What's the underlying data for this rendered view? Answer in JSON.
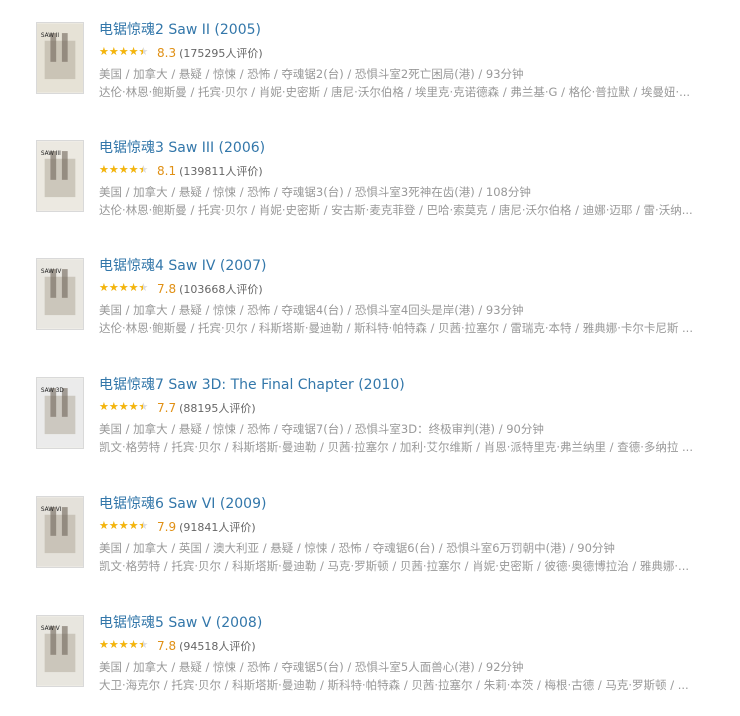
{
  "movies": [
    {
      "title": "电锯惊魂2 Saw II (2005)",
      "rating": 8.3,
      "stars_fraction": 0.8,
      "score": "8.3",
      "votes": "(175295人评价)",
      "meta": "美国 / 加拿大 / 悬疑 / 惊悚 / 恐怖 / 夺魂锯2(台) / 恐惧斗室2死亡困局(港) / 93分钟",
      "cast": "达伦·林恩·鲍斯曼 / 托宾·贝尔 / 肖妮·史密斯 / 唐尼·沃尔伯格 / 埃里克·克诺德森 / 弗兰基·G / 格伦·普拉默 / 埃曼妞·...",
      "poster_label": "SAW II",
      "poster_color": "#e6e2d6"
    },
    {
      "title": "电锯惊魂3 Saw III (2006)",
      "rating": 8.1,
      "stars_fraction": 0.8,
      "score": "8.1",
      "votes": "(139811人评价)",
      "meta": "美国 / 加拿大 / 悬疑 / 惊悚 / 恐怖 / 夺魂锯3(台) / 恐惧斗室3死神在齿(港) / 108分钟",
      "cast": "达伦·林恩·鲍斯曼 / 托宾·贝尔 / 肖妮·史密斯 / 安古斯·麦克菲登 / 巴哈·索莫克 / 唐尼·沃尔伯格 / 迪娜·迈耶 / 雷·沃纳...",
      "poster_label": "SAW III",
      "poster_color": "#ece9e1"
    },
    {
      "title": "电锯惊魂4 Saw IV (2007)",
      "rating": 7.8,
      "stars_fraction": 0.8,
      "score": "7.8",
      "votes": "(103668人评价)",
      "meta": "美国 / 加拿大 / 悬疑 / 惊悚 / 恐怖 / 夺魂锯4(台) / 恐惧斗室4回头是岸(港) / 93分钟",
      "cast": "达伦·林恩·鲍斯曼 / 托宾·贝尔 / 科斯塔斯·曼迪勒 / 斯科特·帕特森 / 贝茜·拉塞尔 / 雷瑞克·本特 / 雅典娜·卡尔卡尼斯 ...",
      "poster_label": "SAW IV",
      "poster_color": "#e9e7e1"
    },
    {
      "title": "电锯惊魂7 Saw 3D: The Final Chapter (2010)",
      "rating": 7.7,
      "stars_fraction": 0.8,
      "score": "7.7",
      "votes": "(88195人评价)",
      "meta": "美国 / 加拿大 / 悬疑 / 惊悚 / 恐怖 / 夺魂锯7(台) / 恐惧斗室3D：终极审判(港) / 90分钟",
      "cast": "凯文·格劳特 / 托宾·贝尔 / 科斯塔斯·曼迪勒 / 贝茜·拉塞尔 / 加利·艾尔维斯 / 肖恩·派特里克·弗兰纳里 / 查德·多纳拉 ...",
      "poster_label": "SAW 3D",
      "poster_color": "#ebebeb"
    },
    {
      "title": "电锯惊魂6 Saw VI (2009)",
      "rating": 7.9,
      "stars_fraction": 0.8,
      "score": "7.9",
      "votes": "(91841人评价)",
      "meta": "美国 / 加拿大 / 英国 / 澳大利亚 / 悬疑 / 惊悚 / 恐怖 / 夺魂锯6(台) / 恐惧斗室6万罚朝中(港) / 90分钟",
      "cast": "凯文·格劳特 / 托宾·贝尔 / 科斯塔斯·曼迪勒 / 马克·罗斯顿 / 贝茜·拉塞尔 / 肖妮·史密斯 / 彼德·奥德博拉治 / 雅典娜·...",
      "poster_label": "SAW VI",
      "poster_color": "#e4e1da"
    },
    {
      "title": "电锯惊魂5 Saw V (2008)",
      "rating": 7.8,
      "stars_fraction": 0.8,
      "score": "7.8",
      "votes": "(94518人评价)",
      "meta": "美国 / 加拿大 / 悬疑 / 惊悚 / 恐怖 / 夺魂锯5(台) / 恐惧斗室5人面兽心(港) / 92分钟",
      "cast": "大卫·海克尔 / 托宾·贝尔 / 科斯塔斯·曼迪勒 / 斯科特·帕特森 / 贝茜·拉塞尔 / 朱莉·本茨 / 梅根·古德 / 马克·罗斯顿 / ...",
      "poster_label": "SAW V",
      "poster_color": "#e8e6df"
    }
  ]
}
